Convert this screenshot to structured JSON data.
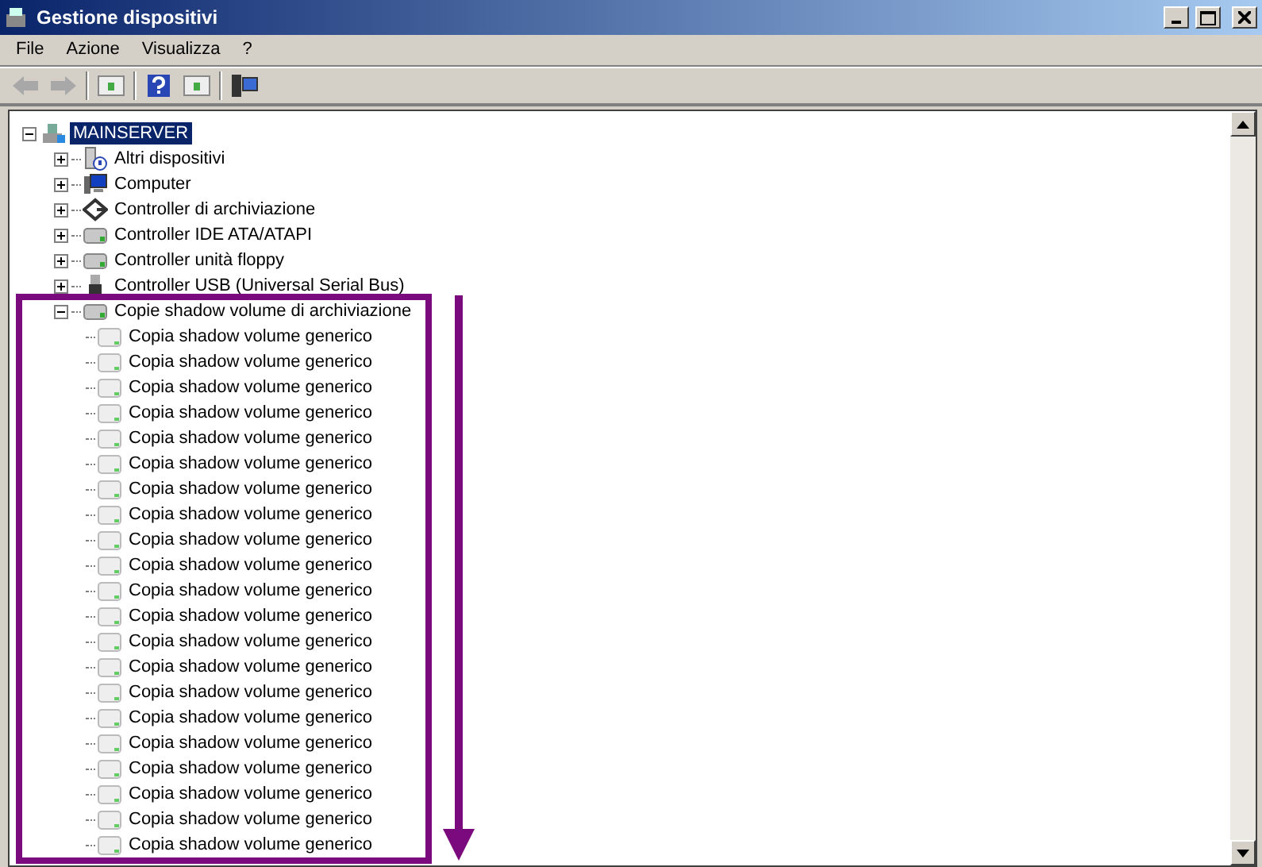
{
  "window": {
    "title": "Gestione dispositivi"
  },
  "menu": [
    "File",
    "Azione",
    "Visualizza",
    "?"
  ],
  "tree": [
    {
      "label": "MAINSERVER",
      "kind": "computer",
      "selected": true,
      "expanded": true,
      "children": [
        {
          "label": "Altri dispositivi",
          "kind": "unknown",
          "selected": false,
          "expanded": false
        },
        {
          "label": "Computer",
          "kind": "monitor",
          "selected": false,
          "expanded": false
        },
        {
          "label": "Controller di archiviazione",
          "kind": "storage",
          "selected": false,
          "expanded": false
        },
        {
          "label": "Controller IDE ATA/ATAPI",
          "kind": "drive",
          "selected": false,
          "expanded": false
        },
        {
          "label": "Controller unità floppy",
          "kind": "drive",
          "selected": false,
          "expanded": false
        },
        {
          "label": "Controller USB (Universal Serial Bus)",
          "kind": "usb",
          "selected": false,
          "expanded": false
        },
        {
          "label": "Copie shadow volume di archiviazione",
          "kind": "drive",
          "selected": false,
          "expanded": true,
          "children": [
            {
              "label": "Copia shadow volume generico",
              "kind": "volume",
              "selected": false
            },
            {
              "label": "Copia shadow volume generico",
              "kind": "volume",
              "selected": false
            },
            {
              "label": "Copia shadow volume generico",
              "kind": "volume",
              "selected": false
            },
            {
              "label": "Copia shadow volume generico",
              "kind": "volume",
              "selected": false
            },
            {
              "label": "Copia shadow volume generico",
              "kind": "volume",
              "selected": false
            },
            {
              "label": "Copia shadow volume generico",
              "kind": "volume",
              "selected": false
            },
            {
              "label": "Copia shadow volume generico",
              "kind": "volume",
              "selected": false
            },
            {
              "label": "Copia shadow volume generico",
              "kind": "volume",
              "selected": false
            },
            {
              "label": "Copia shadow volume generico",
              "kind": "volume",
              "selected": false
            },
            {
              "label": "Copia shadow volume generico",
              "kind": "volume",
              "selected": false
            },
            {
              "label": "Copia shadow volume generico",
              "kind": "volume",
              "selected": false
            },
            {
              "label": "Copia shadow volume generico",
              "kind": "volume",
              "selected": false
            },
            {
              "label": "Copia shadow volume generico",
              "kind": "volume",
              "selected": false
            },
            {
              "label": "Copia shadow volume generico",
              "kind": "volume",
              "selected": false
            },
            {
              "label": "Copia shadow volume generico",
              "kind": "volume",
              "selected": false
            },
            {
              "label": "Copia shadow volume generico",
              "kind": "volume",
              "selected": false
            },
            {
              "label": "Copia shadow volume generico",
              "kind": "volume",
              "selected": false
            },
            {
              "label": "Copia shadow volume generico",
              "kind": "volume",
              "selected": false
            },
            {
              "label": "Copia shadow volume generico",
              "kind": "volume",
              "selected": false
            },
            {
              "label": "Copia shadow volume generico",
              "kind": "volume",
              "selected": false
            },
            {
              "label": "Copia shadow volume generico",
              "kind": "volume",
              "selected": false
            }
          ]
        }
      ]
    }
  ]
}
